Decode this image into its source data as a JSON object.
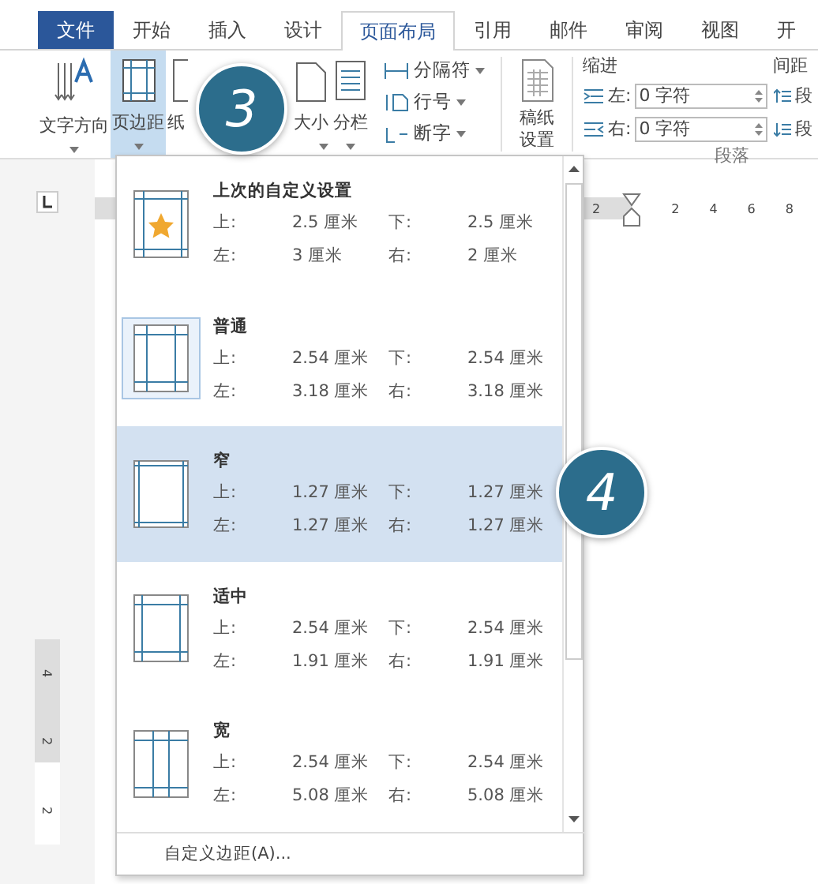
{
  "tabs": [
    {
      "label": "文件",
      "kind": "file",
      "selected": false
    },
    {
      "label": "开始",
      "kind": "tab",
      "selected": false
    },
    {
      "label": "插入",
      "kind": "tab",
      "selected": false
    },
    {
      "label": "设计",
      "kind": "tab",
      "selected": false
    },
    {
      "label": "页面布局",
      "kind": "tab",
      "selected": true
    },
    {
      "label": "引用",
      "kind": "tab",
      "selected": false
    },
    {
      "label": "邮件",
      "kind": "tab",
      "selected": false
    },
    {
      "label": "审阅",
      "kind": "tab",
      "selected": false
    },
    {
      "label": "视图",
      "kind": "tab",
      "selected": false
    },
    {
      "label": "开",
      "kind": "tab",
      "selected": false
    }
  ],
  "ribbon": {
    "large_buttons": [
      {
        "label": "文字方向",
        "kind": "text-direction",
        "selected": false,
        "caret": true
      },
      {
        "label": "页边距",
        "kind": "margins",
        "selected": true,
        "caret": true
      },
      {
        "label": "纸",
        "kind": "orientation",
        "selected": false,
        "caret": false
      },
      {
        "label": "大小",
        "kind": "size",
        "selected": false,
        "caret": true
      },
      {
        "label": "分栏",
        "kind": "columns",
        "selected": false,
        "caret": true
      }
    ],
    "small_buttons": [
      {
        "label": "分隔符",
        "kind": "breaks"
      },
      {
        "label": "行号",
        "kind": "line-numbers"
      },
      {
        "label": "断字",
        "kind": "hyphenation"
      }
    ],
    "draft_button": {
      "label": "稿纸设置"
    },
    "indent": {
      "title": "缩进",
      "fields": [
        {
          "label": "左:",
          "value": "0 字符",
          "kind": "left"
        },
        {
          "label": "右:",
          "value": "0 字符",
          "kind": "right"
        }
      ]
    },
    "spacing": {
      "title": "间距",
      "fields": [
        {
          "label": "段",
          "kind": "before"
        },
        {
          "label": "段",
          "kind": "after"
        }
      ]
    },
    "group_label": "段落"
  },
  "ruler": {
    "horizontal": [
      "2",
      "2",
      "4",
      "6",
      "8"
    ],
    "vertical": [
      "4",
      "2",
      "2"
    ]
  },
  "margin_menu": {
    "items": [
      {
        "title": "上次的自定义设置",
        "kind": "custom",
        "current": false,
        "selected": false,
        "top_label": "上:",
        "top": "2.5 厘米",
        "bottom_label": "下:",
        "bottom": "2.5 厘米",
        "left_label": "左:",
        "left": "3 厘米",
        "right_label": "右:",
        "right": "2 厘米"
      },
      {
        "title": "普通",
        "kind": "normal",
        "current": true,
        "selected": false,
        "top_label": "上:",
        "top": "2.54 厘米",
        "bottom_label": "下:",
        "bottom": "2.54 厘米",
        "left_label": "左:",
        "left": "3.18 厘米",
        "right_label": "右:",
        "right": "3.18 厘米"
      },
      {
        "title": "窄",
        "kind": "narrow",
        "current": false,
        "selected": true,
        "top_label": "上:",
        "top": "1.27 厘米",
        "bottom_label": "下:",
        "bottom": "1.27 厘米",
        "left_label": "左:",
        "left": "1.27 厘米",
        "right_label": "右:",
        "right": "1.27 厘米"
      },
      {
        "title": "适中",
        "kind": "moderate",
        "current": false,
        "selected": false,
        "top_label": "上:",
        "top": "2.54 厘米",
        "bottom_label": "下:",
        "bottom": "2.54 厘米",
        "left_label": "左:",
        "left": "1.91 厘米",
        "right_label": "右:",
        "right": "1.91 厘米"
      },
      {
        "title": "宽",
        "kind": "wide",
        "current": false,
        "selected": false,
        "top_label": "上:",
        "top": "2.54 厘米",
        "bottom_label": "下:",
        "bottom": "2.54 厘米",
        "left_label": "左:",
        "left": "5.08 厘米",
        "right_label": "右:",
        "right": "5.08 厘米"
      }
    ],
    "footer": "自定义边距(A)..."
  },
  "callouts": [
    "3",
    "4"
  ]
}
